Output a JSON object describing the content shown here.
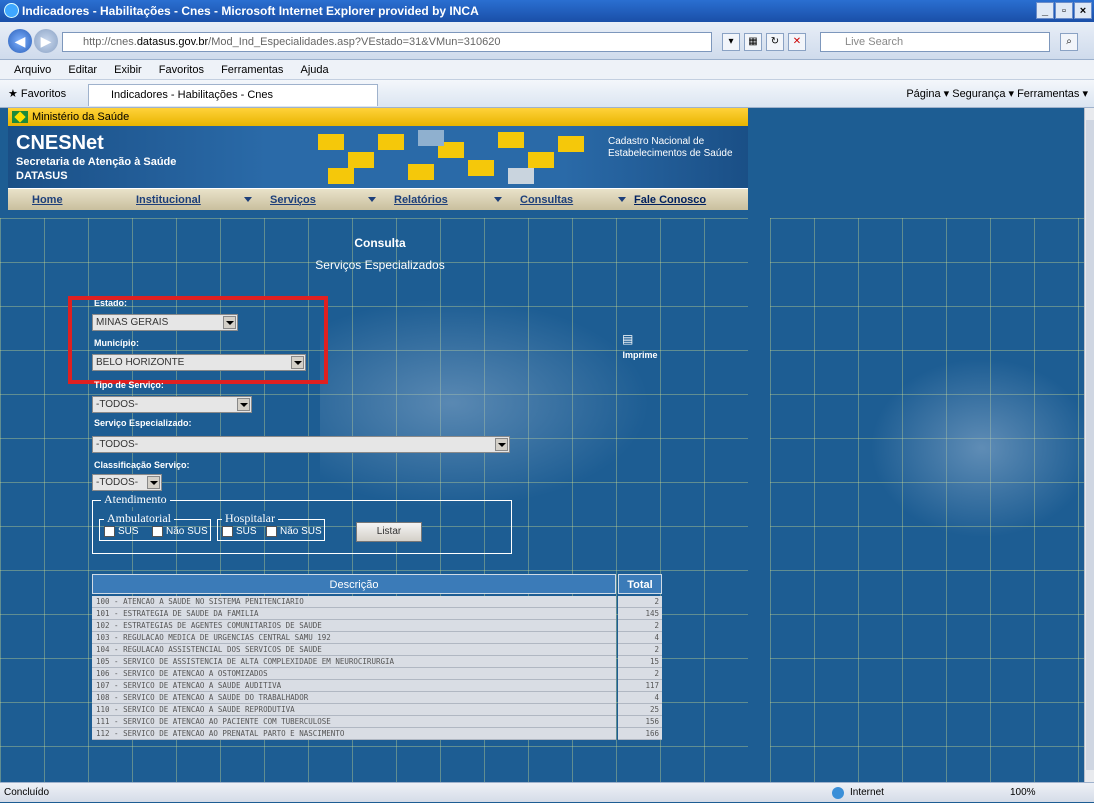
{
  "browser": {
    "title": "Indicadores - Habilitações - Cnes - Microsoft Internet Explorer provided by INCA",
    "url_prefix": "http://cnes.",
    "url_domain": "datasus.gov.br",
    "url_rest": "/Mod_Ind_Especialidades.asp?VEstado=31&VMun=310620",
    "search_placeholder": "Live Search",
    "menu": [
      "Arquivo",
      "Editar",
      "Exibir",
      "Favoritos",
      "Ferramentas",
      "Ajuda"
    ],
    "favorites_label": "Favoritos",
    "tab_label": "Indicadores - Habilitações - Cnes",
    "toolbar_right": "Página ▾  Segurança ▾  Ferramentas ▾",
    "status_left": "Concluído",
    "status_zone": "Internet",
    "status_zoom": "100%"
  },
  "site": {
    "ministerio": "Ministério da Saúde",
    "brand": "CNESNet",
    "brand_sub": "Secretaria de Atenção à Saúde",
    "brand_sub2": "DATASUS",
    "cadastro": "Cadastro Nacional de Estabelecimentos de Saúde",
    "nav": [
      "Home",
      "Institucional",
      "Serviços",
      "Relatórios",
      "Consultas",
      "Fale Conosco"
    ]
  },
  "form": {
    "title": "Consulta",
    "subtitle": "Serviços Especializados",
    "estado_label": "Estado:",
    "estado_value": "MINAS GERAIS",
    "municipio_label": "Município:",
    "municipio_value": "BELO HORIZONTE",
    "tipo_label": "Tipo de Serviço:",
    "tipo_value": "-TODOS-",
    "servico_label": "Serviço Especializado:",
    "servico_value": "-TODOS-",
    "classificacao_label": "Classificação Serviço:",
    "classificacao_value": "-TODOS-",
    "atendimento_legend": "Atendimento",
    "ambulatorial_legend": "Ambulatorial",
    "hospitalar_legend": "Hospitalar",
    "sus": "SUS",
    "nao_sus": "Não SUS",
    "listar": "Listar",
    "imprime": "Imprime"
  },
  "table": {
    "headers": [
      "Descrição",
      "Total"
    ],
    "rows": [
      {
        "desc": "100 - ATENCAO A SAUDE NO SISTEMA PENITENCIARIO",
        "total": "2"
      },
      {
        "desc": "101 - ESTRATEGIA DE SAUDE DA FAMILIA",
        "total": "145"
      },
      {
        "desc": "102 - ESTRATEGIAS DE AGENTES COMUNITARIOS DE SAUDE",
        "total": "2"
      },
      {
        "desc": "103 - REGULACAO MEDICA DE URGENCIAS CENTRAL SAMU 192",
        "total": "4"
      },
      {
        "desc": "104 - REGULACAO ASSISTENCIAL DOS SERVICOS DE SAUDE",
        "total": "2"
      },
      {
        "desc": "105 - SERVICO DE ASSISTENCIA DE ALTA COMPLEXIDADE EM NEUROCIRURGIA",
        "total": "15"
      },
      {
        "desc": "106 - SERVICO DE ATENCAO A OSTOMIZADOS",
        "total": "2"
      },
      {
        "desc": "107 - SERVICO DE ATENCAO A SAUDE AUDITIVA",
        "total": "117"
      },
      {
        "desc": "108 - SERVICO DE ATENCAO A SAUDE DO TRABALHADOR",
        "total": "4"
      },
      {
        "desc": "110 - SERVICO DE ATENCAO A SAUDE REPRODUTIVA",
        "total": "25"
      },
      {
        "desc": "111 - SERVICO DE ATENCAO AO PACIENTE COM TUBERCULOSE",
        "total": "156"
      },
      {
        "desc": "112 - SERVICO DE ATENCAO AO PRENATAL PARTO E NASCIMENTO",
        "total": "166"
      }
    ]
  }
}
